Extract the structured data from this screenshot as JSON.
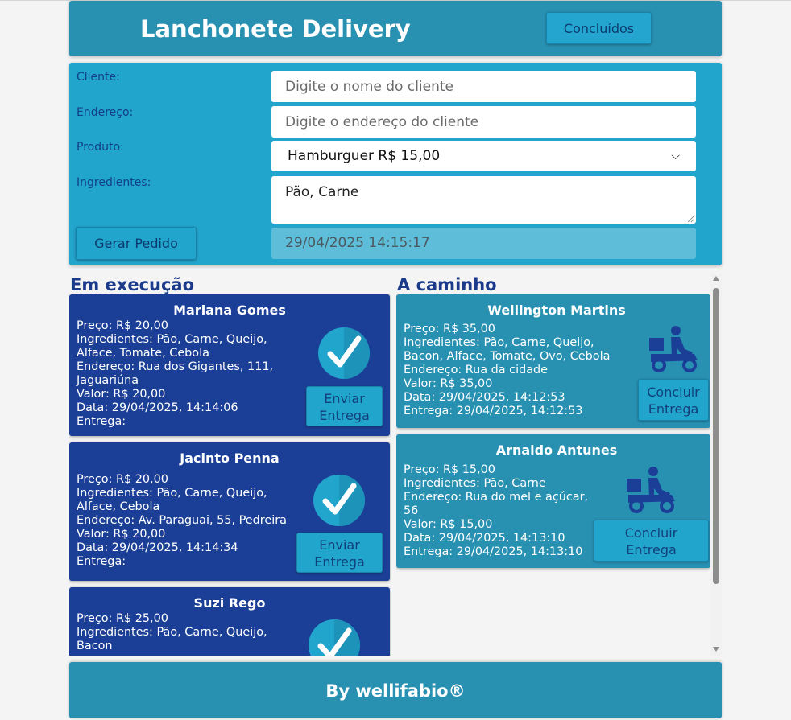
{
  "header": {
    "title": "Lanchonete Delivery",
    "concluidos_label": "Concluídos"
  },
  "form": {
    "cliente_label": "Cliente:",
    "cliente_placeholder": "Digite o nome do cliente",
    "endereco_label": "Endereço:",
    "endereco_placeholder": "Digite o endereço do cliente",
    "produto_label": "Produto:",
    "produto_selected": "Hamburguer R$ 15,00",
    "ingredientes_label": "Ingredientes:",
    "ingredientes_value": "Pão, Carne",
    "gerar_label": "Gerar Pedido",
    "datetime": "29/04/2025 14:15:17"
  },
  "execucao": {
    "title": "Em execução",
    "button_line1": "Enviar",
    "button_line2": "Entrega",
    "cards": [
      {
        "name": "Mariana Gomes",
        "lines": [
          "Preço: R$ 20,00",
          "Ingredientes: Pão, Carne, Queijo,",
          "Alface, Tomate, Cebola",
          "Endereço: Rua dos Gigantes, 111,",
          "Jaguariúna",
          "Valor: R$ 20,00",
          "Data: 29/04/2025, 14:14:06",
          "Entrega:"
        ]
      },
      {
        "name": "Jacinto Penna",
        "lines": [
          "Preço: R$ 20,00",
          "Ingredientes: Pão, Carne, Queijo,",
          "Alface, Cebola",
          "Endereço: Av. Paraguai, 55, Pedreira",
          "Valor: R$ 20,00",
          "Data: 29/04/2025, 14:14:34",
          "Entrega:"
        ]
      },
      {
        "name": "Suzi Rego",
        "lines": [
          "Preço: R$ 25,00",
          "Ingredientes: Pão, Carne, Queijo,",
          "Bacon"
        ]
      }
    ]
  },
  "caminho": {
    "title": "A caminho",
    "button_line1": "Concluir",
    "button_line2": "Entrega",
    "cards": [
      {
        "name": "Wellington Martins",
        "lines": [
          "Preço: R$ 35,00",
          "Ingredientes: Pão, Carne, Queijo,",
          "Bacon, Alface, Tomate, Ovo, Cebola",
          "Endereço: Rua da cidade",
          "Valor: R$ 35,00",
          "Data: 29/04/2025, 14:12:53",
          "Entrega: 29/04/2025, 14:12:53"
        ]
      },
      {
        "name": "Arnaldo Antunes",
        "lines": [
          "Preço: R$ 15,00",
          "Ingredientes: Pão, Carne",
          "Endereço: Rua do mel e açúcar,",
          "56",
          "Valor: R$ 15,00",
          "Data: 29/04/2025, 14:13:10",
          "Entrega: 29/04/2025, 14:13:10"
        ]
      }
    ]
  },
  "footer": {
    "text": "By wellifabio®"
  },
  "icons": {
    "check": "check-circle-icon",
    "delivery": "delivery-motorcycle-icon"
  },
  "colors": {
    "header": "#2891b2",
    "form": "#22a5cd",
    "card_exec": "#1b3f96",
    "card_route": "#2891b2",
    "title": "#1b3a8a"
  }
}
